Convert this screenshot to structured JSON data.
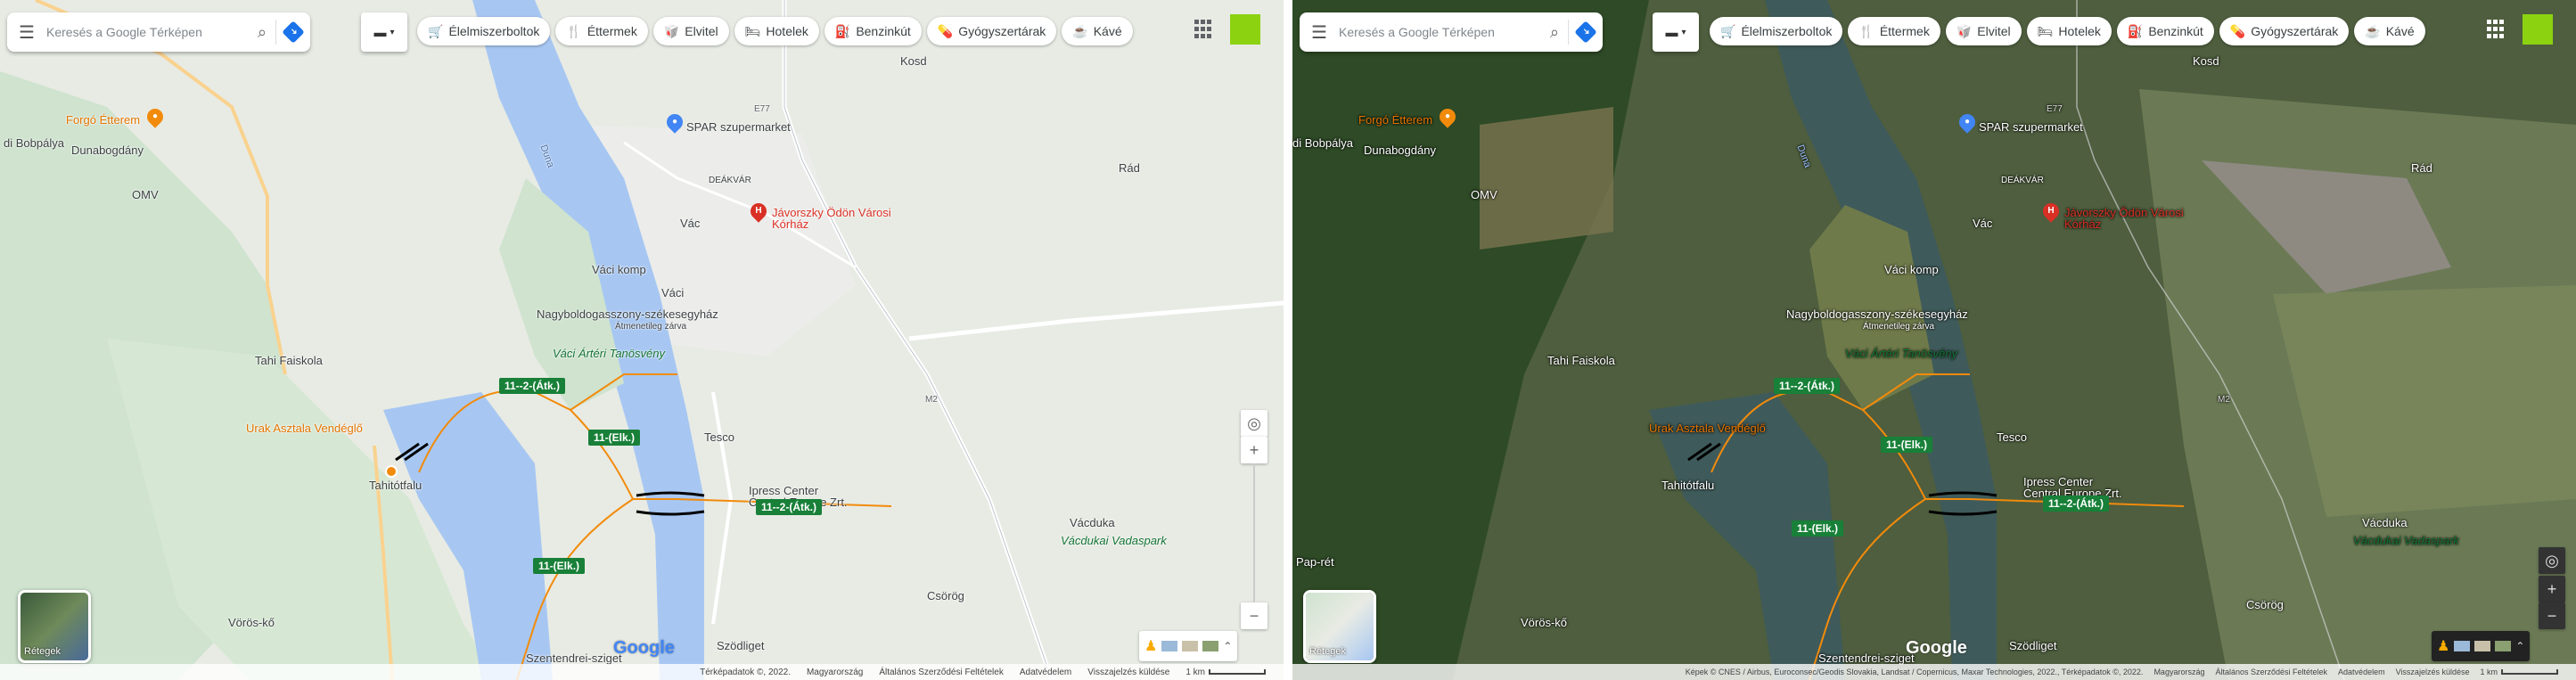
{
  "search": {
    "placeholder": "Keresés a Google Térképen",
    "menu_icon": "menu-icon",
    "search_icon": "search-icon",
    "directions_icon": "directions-icon"
  },
  "transit": {
    "icon": "transit-icon",
    "caret": "▾"
  },
  "chips": [
    {
      "label": "Élelmiszerboltok",
      "icon": "cart-icon"
    },
    {
      "label": "Éttermek",
      "icon": "restaurant-icon"
    },
    {
      "label": "Elvitel",
      "icon": "takeout-icon"
    },
    {
      "label": "Hotelek",
      "icon": "hotel-icon"
    },
    {
      "label": "Benzinkút",
      "icon": "gas-station-icon"
    },
    {
      "label": "Gyógyszertárak",
      "icon": "pharmacy-icon"
    },
    {
      "label": "Kávé",
      "icon": "coffee-icon"
    }
  ],
  "places": {
    "kosd": "Kosd",
    "forgo": "Forgó Étterem",
    "bobpalya": "di Bobpálya",
    "dunabogdany": "Dunabogdány",
    "spar": "SPAR szupermarket",
    "deakvar": "DEÁKVÁR",
    "rad": "Rád",
    "omv": "OMV",
    "vac": "Vác",
    "javorszky": "Jávorszky Ödön Városi Kórház",
    "vaci_komp": "Váci komp",
    "vaci": "Váci",
    "nagyboldog": "Nagyboldogasszony-székesegyház",
    "almenetel": "Átmenetileg zárva",
    "tahi_faiskola": "Tahi Faiskola",
    "arteri": "Váci Ártéri Tanösvény",
    "urak": "Urak Asztala Vendéglő",
    "tesco": "Tesco",
    "tahitotfalu": "Tahitótfalu",
    "ipress": "Ipress Center Central Europe Zrt.",
    "vacduka": "Vácduka",
    "vacdukai": "Vácdukai Vadaspark",
    "csorog": "Csörög",
    "vorosko": "Vörös-kő",
    "szentendrei": "Szentendrei-sziget",
    "szodliget": "Szödliget",
    "papret": "Pap-rét",
    "duna": "Duna"
  },
  "tickets": {
    "t1": "11--2-(Átk.)",
    "t2": "11-(Elk.)",
    "t3": "11--2-(Átk.)",
    "t4": "11-(Elk.)"
  },
  "roads": {
    "e77": "E77",
    "m2": "M2",
    "r11": "11",
    "r2": "2"
  },
  "layers": {
    "label": "Rétegek"
  },
  "logo": "Google",
  "zoom": {
    "in": "+",
    "out": "−"
  },
  "map_footer": {
    "data": "Térképadatok ©, 2022.",
    "country": "Magyarország",
    "terms": "Általános Szerződési Feltételek",
    "privacy": "Adatvédelem",
    "feedback": "Visszajelzés küldése",
    "scale": "1 km"
  },
  "sat_footer": {
    "imagery": "Képek © CNES / Airbus, Euroconsec/Geodis Slovakia, Landsat / Copernicus, Maxar Technologies, 2022., Térképadatok ©, 2022.",
    "country": "Magyarország",
    "terms": "Általános Szerződési Feltételek",
    "privacy": "Adatvédelem",
    "feedback": "Visszajelzés küldése",
    "scale": "1 km"
  },
  "colors": {
    "river": "#a7c7f2",
    "sat_river": "#3f5a5a",
    "ferry_route": "#f28b0b",
    "ticket": "#188038",
    "account": "#8cd211"
  }
}
